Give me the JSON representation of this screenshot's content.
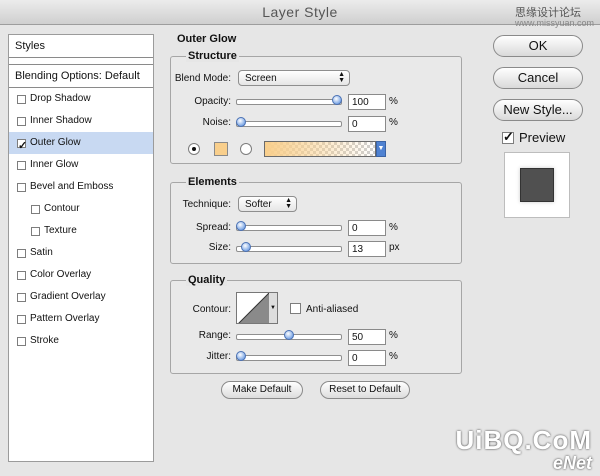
{
  "window": {
    "title": "Layer Style",
    "watermark_top": "思缘设计论坛",
    "watermark_top_sub": "www.missyuan.com",
    "watermark_bottom": "UiBQ.CoM",
    "watermark_bottom2": "eNet"
  },
  "sidebar": {
    "header": "Styles",
    "blending": "Blending Options: Default",
    "items": [
      {
        "label": "Drop Shadow",
        "checked": false
      },
      {
        "label": "Inner Shadow",
        "checked": false
      },
      {
        "label": "Outer Glow",
        "checked": true,
        "selected": true
      },
      {
        "label": "Inner Glow",
        "checked": false
      },
      {
        "label": "Bevel and Emboss",
        "checked": false
      },
      {
        "label": "Contour",
        "checked": false,
        "indent": true
      },
      {
        "label": "Texture",
        "checked": false,
        "indent": true
      },
      {
        "label": "Satin",
        "checked": false
      },
      {
        "label": "Color Overlay",
        "checked": false
      },
      {
        "label": "Gradient Overlay",
        "checked": false
      },
      {
        "label": "Pattern Overlay",
        "checked": false
      },
      {
        "label": "Stroke",
        "checked": false
      }
    ]
  },
  "panel": {
    "title": "Outer Glow",
    "structure": {
      "title": "Structure",
      "blend_mode_label": "Blend Mode:",
      "blend_mode": "Screen",
      "opacity_label": "Opacity:",
      "opacity": "100",
      "opacity_unit": "%",
      "opacity_level": 1.0,
      "noise_label": "Noise:",
      "noise": "0",
      "noise_unit": "%",
      "noise_level": 0.0,
      "color": "#f9cf8c"
    },
    "elements": {
      "title": "Elements",
      "technique_label": "Technique:",
      "technique": "Softer",
      "spread_label": "Spread:",
      "spread": "0",
      "spread_unit": "%",
      "spread_level": 0.0,
      "size_label": "Size:",
      "size": "13",
      "size_unit": "px",
      "size_level": 0.052
    },
    "quality": {
      "title": "Quality",
      "contour_label": "Contour:",
      "anti_aliased_label": "Anti-aliased",
      "anti_aliased": false,
      "range_label": "Range:",
      "range": "50",
      "range_unit": "%",
      "range_level": 0.5,
      "jitter_label": "Jitter:",
      "jitter": "0",
      "jitter_unit": "%",
      "jitter_level": 0.0
    },
    "make_default": "Make Default",
    "reset_default": "Reset to Default"
  },
  "actions": {
    "ok": "OK",
    "cancel": "Cancel",
    "new_style": "New Style...",
    "preview": "Preview",
    "preview_checked": true
  }
}
